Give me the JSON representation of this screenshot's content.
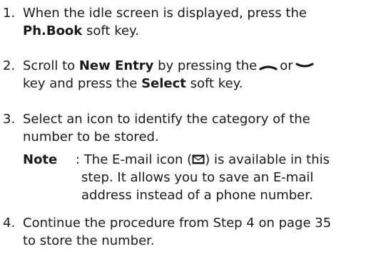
{
  "steps": [
    {
      "num": "1.",
      "l1_a": "When the idle screen is displayed, press the",
      "l2_bold": "Ph.Book",
      "l2_b": " soft key."
    },
    {
      "num": "2.",
      "l1_a": "Scroll to ",
      "l1_bold": "New Entry",
      "l1_b": " by pressing the",
      "l1_or": "or",
      "l2_a": "key and press the ",
      "l2_bold": "Select",
      "l2_b": " soft key."
    },
    {
      "num": "3.",
      "l1": "Select an icon to identify the category of the",
      "l2": "number to be stored."
    },
    {
      "num": "4.",
      "l1": "Continue the procedure from Step 4 on page 35",
      "l2": "to store the number."
    }
  ],
  "note": {
    "label": "Note",
    "l1_a": ": The E-mail icon (",
    "l1_b": ") is available in this",
    "l2": "step. It allows you to save an E-mail",
    "l3": "address instead of a phone number."
  },
  "icons": {
    "up_key": "nav-up-key-icon",
    "down_key": "nav-down-key-icon",
    "email": "email-icon"
  }
}
